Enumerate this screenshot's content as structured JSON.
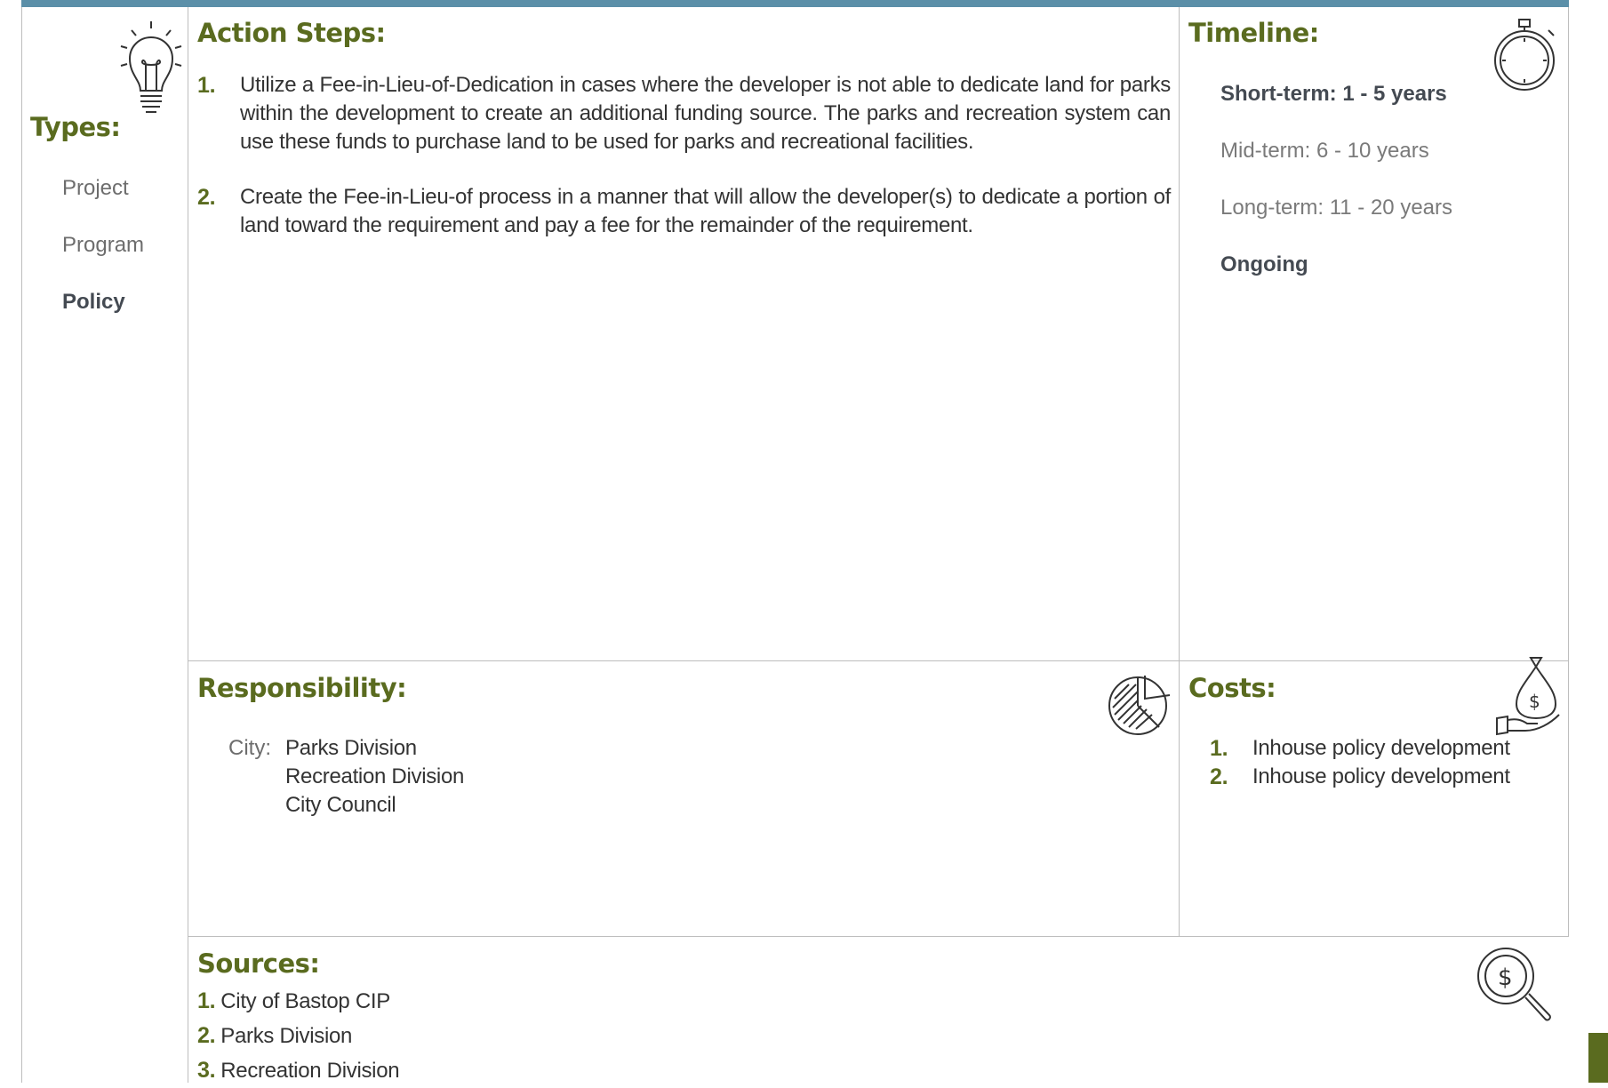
{
  "colors": {
    "accent": "#5a6b1f",
    "topbar": "#5b8fa8"
  },
  "types": {
    "heading": "Types:",
    "items": [
      {
        "label": "Project",
        "selected": false
      },
      {
        "label": "Program",
        "selected": false
      },
      {
        "label": "Policy",
        "selected": true
      }
    ],
    "icon": "lightbulb-icon"
  },
  "action_steps": {
    "heading": "Action Steps:",
    "items": [
      {
        "num": "1.",
        "text": "Utilize a Fee-in-Lieu-of-Dedication in cases where the developer is not able to dedicate land for parks within the development to create an additional funding source. The parks and recreation system can use these funds to purchase land to be used for parks and recreational facilities."
      },
      {
        "num": "2.",
        "text": "Create the Fee-in-Lieu-of process in a manner that will allow the developer(s) to dedicate a portion of land toward the requirement and pay a fee for the remainder of the requirement."
      }
    ]
  },
  "timeline": {
    "heading": "Timeline:",
    "icon": "stopwatch-icon",
    "items": [
      {
        "label": "Short-term:  1 - 5 years",
        "selected": true
      },
      {
        "label": "Mid-term:  6 - 10 years",
        "selected": false
      },
      {
        "label": "Long-term:  11 - 20 years",
        "selected": false
      },
      {
        "label": "Ongoing",
        "selected": true
      }
    ]
  },
  "responsibility": {
    "heading": "Responsibility:",
    "icon": "pie-chart-icon",
    "label": "City:",
    "values": [
      "Parks Division",
      "Recreation Division",
      "City Council"
    ]
  },
  "costs": {
    "heading": "Costs:",
    "icon": "money-bag-hand-icon",
    "items": [
      {
        "num": "1.",
        "text": "Inhouse policy development"
      },
      {
        "num": "2.",
        "text": "Inhouse policy development"
      }
    ]
  },
  "sources": {
    "heading": "Sources:",
    "icon": "magnifier-dollar-icon",
    "items": [
      {
        "num": "1.",
        "text": "City of Bastop CIP"
      },
      {
        "num": "2.",
        "text": "Parks Division"
      },
      {
        "num": "3.",
        "text": "Recreation Division"
      }
    ]
  }
}
